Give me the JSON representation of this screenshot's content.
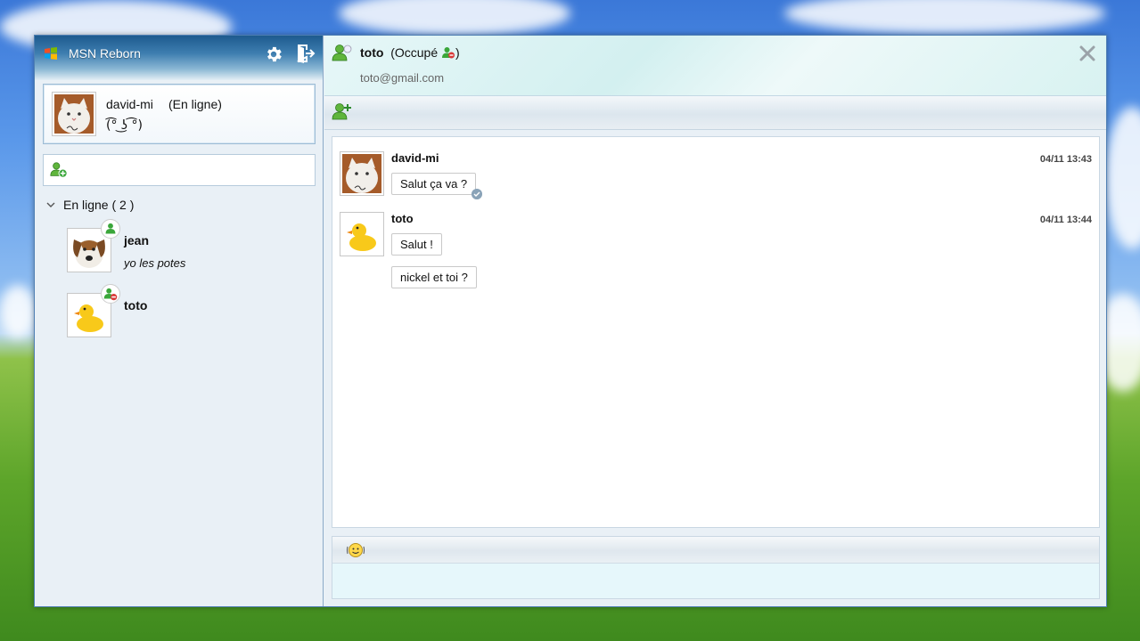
{
  "app": {
    "title": "MSN Reborn"
  },
  "me": {
    "name": "david-mi",
    "status": "(En ligne)",
    "mood": "(͡° ͜ʖ ͡°)"
  },
  "contacts": {
    "group_label": "En ligne ( 2 )",
    "items": [
      {
        "name": "jean",
        "message": "yo les potes",
        "status": "online"
      },
      {
        "name": "toto",
        "message": "",
        "status": "busy"
      }
    ]
  },
  "chat": {
    "contact_name": "toto",
    "contact_status": "(Occupé",
    "status_close": ")",
    "contact_email": "toto@gmail.com",
    "messages": [
      {
        "author": "david-mi",
        "time": "04/11 13:43",
        "texts": [
          "Salut ça va ?"
        ]
      },
      {
        "author": "toto",
        "time": "04/11 13:44",
        "texts": [
          "Salut !",
          "nickel et toi ?"
        ]
      }
    ]
  },
  "composer": {
    "value": ""
  },
  "icons": {
    "app_logo": "windows-logo-icon",
    "settings": "gear-icon",
    "logout": "exit-icon",
    "add_contact": "add-user-icon",
    "close": "close-icon",
    "smiley": "smiley-icon"
  },
  "colors": {
    "title_bar": "#1d5a8e",
    "online": "#3aa63a",
    "busy": "#d93a3a"
  }
}
